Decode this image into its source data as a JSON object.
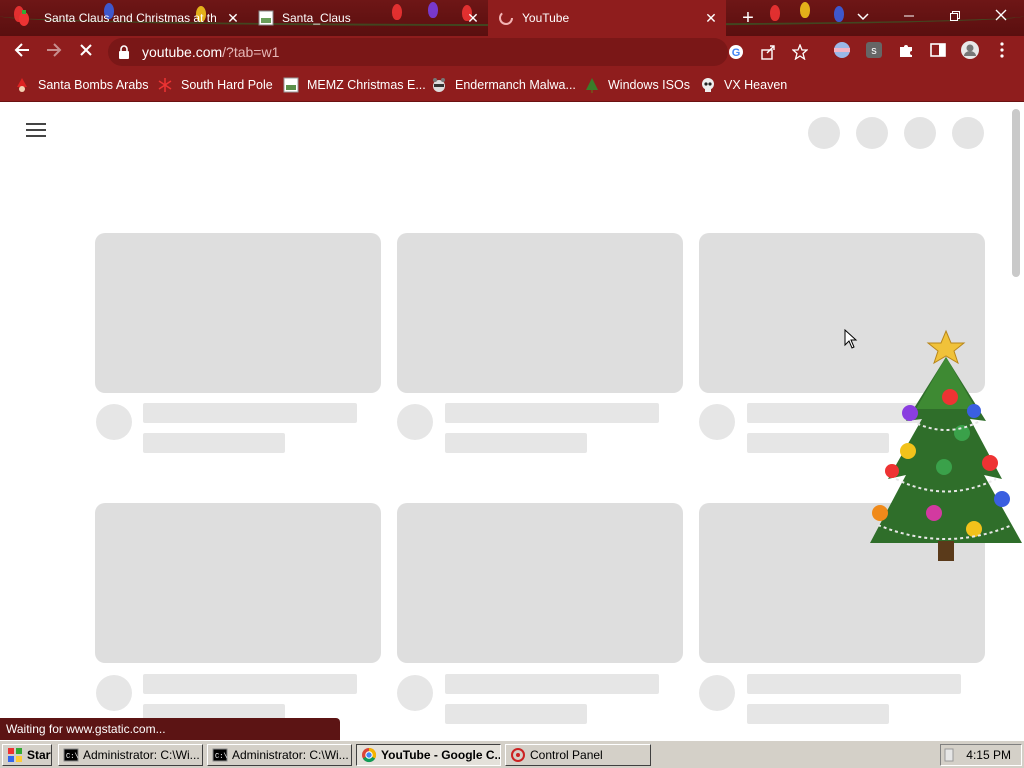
{
  "tabs": [
    {
      "title": "Santa Claus and Christmas at the",
      "icon": "christmas-light-icon"
    },
    {
      "title": "Santa_Claus",
      "icon": "image-file-icon"
    },
    {
      "title": "YouTube",
      "icon": "loading-spinner-icon",
      "active": true
    }
  ],
  "toolbar": {
    "url_host": "youtube.com",
    "url_path": "/?tab=w1"
  },
  "bookmarks": [
    {
      "label": "Santa Bombs Arabs",
      "icon": "santa-icon"
    },
    {
      "label": "South Hard Pole",
      "icon": "snowflake-icon"
    },
    {
      "label": "MEMZ Christmas E...",
      "icon": "image-file-icon"
    },
    {
      "label": "Endermanch Malwa...",
      "icon": "raccoon-icon"
    },
    {
      "label": "Windows ISOs",
      "icon": "christmas-tree-icon"
    },
    {
      "label": "VX Heaven",
      "icon": "skull-icon"
    }
  ],
  "status": {
    "text": "Waiting for www.gstatic.com..."
  },
  "taskbar": {
    "start_label": "Start",
    "items": [
      {
        "label": "Administrator: C:\\Wi...",
        "icon": "cmd-icon"
      },
      {
        "label": "Administrator: C:\\Wi...",
        "icon": "cmd-icon"
      },
      {
        "label": "YouTube - Google C...",
        "icon": "chrome-icon",
        "pressed": true
      },
      {
        "label": "Control Panel",
        "icon": "control-panel-icon"
      }
    ],
    "clock": "4:15 PM"
  },
  "colors": {
    "frame": "#8f1d1d",
    "placeholder": "#dedede",
    "taskbar": "#d4d0c8"
  }
}
